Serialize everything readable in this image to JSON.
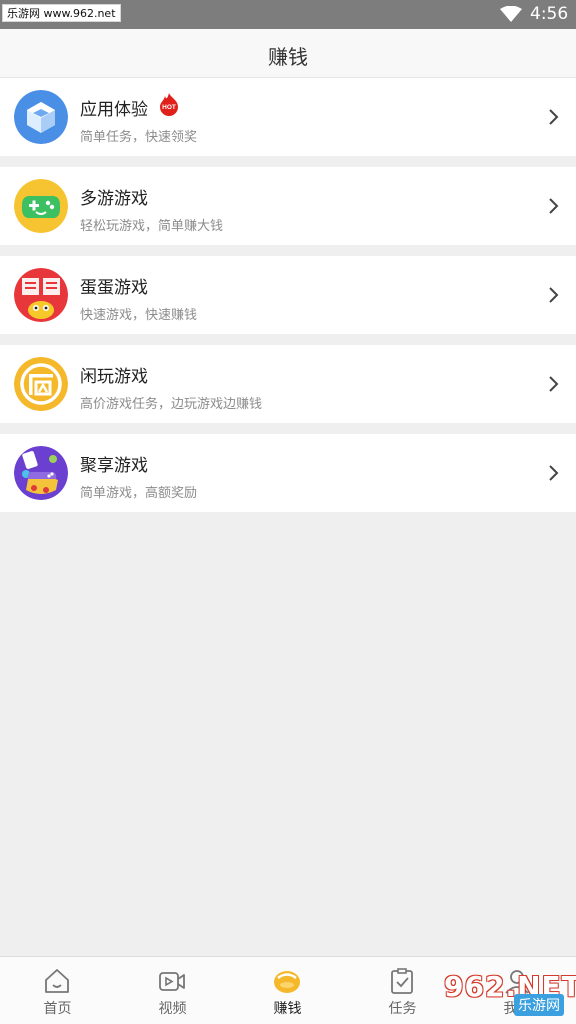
{
  "status_bar": {
    "watermark": "乐游网 www.962.net",
    "time": "4:56"
  },
  "header": {
    "title": "赚钱"
  },
  "list": [
    {
      "name": "应用体验",
      "desc": "简单任务，快速领奖",
      "icon": "app-box-icon",
      "badge": "HOT"
    },
    {
      "name": "多游游戏",
      "desc": "轻松玩游戏，简单赚大钱",
      "icon": "gamepad-icon"
    },
    {
      "name": "蛋蛋游戏",
      "desc": "快速游戏，快速赚钱",
      "icon": "dandan-icon"
    },
    {
      "name": "闲玩游戏",
      "desc": "高价游戏任务，边玩游戏边赚钱",
      "icon": "xianwan-icon"
    },
    {
      "name": "聚享游戏",
      "desc": "简单游戏，高额奖励",
      "icon": "juxiang-icon"
    }
  ],
  "tabs": [
    {
      "label": "首页",
      "icon": "home-icon"
    },
    {
      "label": "视频",
      "icon": "video-icon"
    },
    {
      "label": "赚钱",
      "icon": "coin-icon",
      "active": true
    },
    {
      "label": "任务",
      "icon": "task-icon"
    },
    {
      "label": "我的",
      "icon": "profile-icon"
    }
  ],
  "overlay_watermark": {
    "brand": "962.NET",
    "sub": "乐游网"
  },
  "colors": {
    "accent": "#f5b82a",
    "hot": "#e0201a",
    "divider": "#efefef"
  }
}
